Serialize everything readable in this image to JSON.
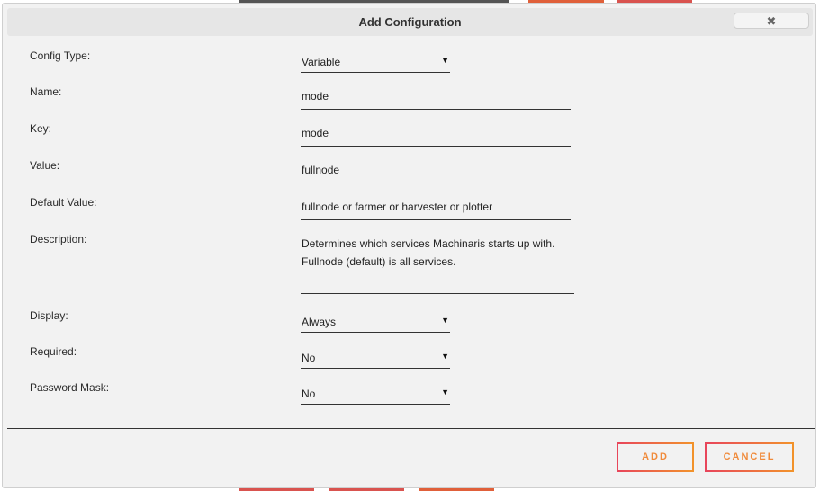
{
  "dialog": {
    "title": "Add Configuration",
    "close_icon": "close-icon",
    "close_glyph": "✖"
  },
  "form": {
    "config_type": {
      "label": "Config Type:",
      "value": "Variable"
    },
    "name": {
      "label": "Name:",
      "value": "mode"
    },
    "key": {
      "label": "Key:",
      "value": "mode"
    },
    "value": {
      "label": "Value:",
      "value": "fullnode"
    },
    "default_value": {
      "label": "Default Value:",
      "value": "fullnode or farmer or harvester or plotter"
    },
    "description": {
      "label": "Description:",
      "value": "Determines which services Machinaris starts up with.  Fullnode (default) is all services."
    },
    "display": {
      "label": "Display:",
      "value": "Always"
    },
    "required": {
      "label": "Required:",
      "value": "No"
    },
    "password_mask": {
      "label": "Password Mask:",
      "value": "No"
    },
    "dropdown_caret": "▼"
  },
  "footer": {
    "add_label": "ADD",
    "cancel_label": "CANCEL"
  },
  "colors": {
    "accent_start": "#e8455b",
    "accent_end": "#f2932b",
    "button_text": "#f08a3a",
    "dialog_bg": "#f2f2f2",
    "titlebar_bg": "#e6e6e6"
  }
}
